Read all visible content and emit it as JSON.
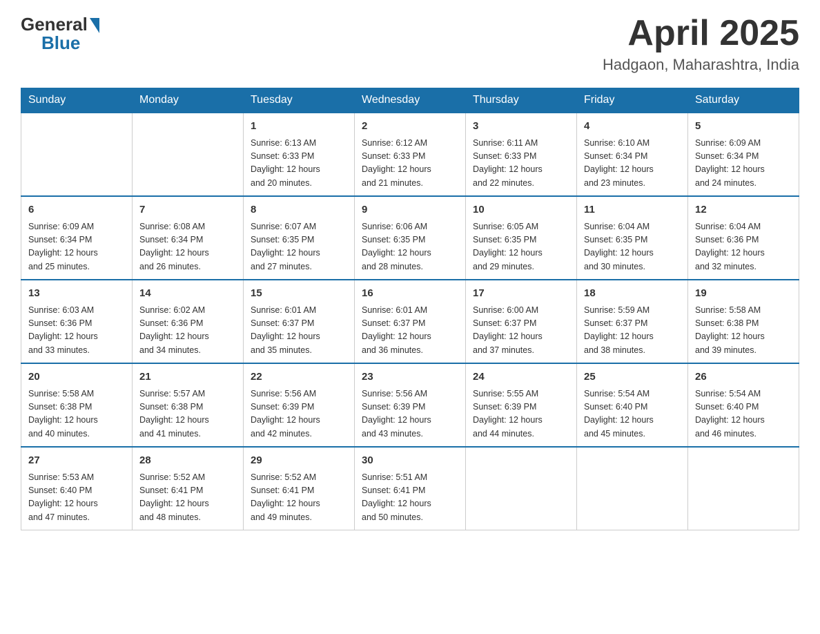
{
  "header": {
    "logo_general": "General",
    "logo_blue": "Blue",
    "month_title": "April 2025",
    "location": "Hadgaon, Maharashtra, India"
  },
  "days_of_week": [
    "Sunday",
    "Monday",
    "Tuesday",
    "Wednesday",
    "Thursday",
    "Friday",
    "Saturday"
  ],
  "weeks": [
    [
      {
        "num": "",
        "info": ""
      },
      {
        "num": "",
        "info": ""
      },
      {
        "num": "1",
        "info": "Sunrise: 6:13 AM\nSunset: 6:33 PM\nDaylight: 12 hours\nand 20 minutes."
      },
      {
        "num": "2",
        "info": "Sunrise: 6:12 AM\nSunset: 6:33 PM\nDaylight: 12 hours\nand 21 minutes."
      },
      {
        "num": "3",
        "info": "Sunrise: 6:11 AM\nSunset: 6:33 PM\nDaylight: 12 hours\nand 22 minutes."
      },
      {
        "num": "4",
        "info": "Sunrise: 6:10 AM\nSunset: 6:34 PM\nDaylight: 12 hours\nand 23 minutes."
      },
      {
        "num": "5",
        "info": "Sunrise: 6:09 AM\nSunset: 6:34 PM\nDaylight: 12 hours\nand 24 minutes."
      }
    ],
    [
      {
        "num": "6",
        "info": "Sunrise: 6:09 AM\nSunset: 6:34 PM\nDaylight: 12 hours\nand 25 minutes."
      },
      {
        "num": "7",
        "info": "Sunrise: 6:08 AM\nSunset: 6:34 PM\nDaylight: 12 hours\nand 26 minutes."
      },
      {
        "num": "8",
        "info": "Sunrise: 6:07 AM\nSunset: 6:35 PM\nDaylight: 12 hours\nand 27 minutes."
      },
      {
        "num": "9",
        "info": "Sunrise: 6:06 AM\nSunset: 6:35 PM\nDaylight: 12 hours\nand 28 minutes."
      },
      {
        "num": "10",
        "info": "Sunrise: 6:05 AM\nSunset: 6:35 PM\nDaylight: 12 hours\nand 29 minutes."
      },
      {
        "num": "11",
        "info": "Sunrise: 6:04 AM\nSunset: 6:35 PM\nDaylight: 12 hours\nand 30 minutes."
      },
      {
        "num": "12",
        "info": "Sunrise: 6:04 AM\nSunset: 6:36 PM\nDaylight: 12 hours\nand 32 minutes."
      }
    ],
    [
      {
        "num": "13",
        "info": "Sunrise: 6:03 AM\nSunset: 6:36 PM\nDaylight: 12 hours\nand 33 minutes."
      },
      {
        "num": "14",
        "info": "Sunrise: 6:02 AM\nSunset: 6:36 PM\nDaylight: 12 hours\nand 34 minutes."
      },
      {
        "num": "15",
        "info": "Sunrise: 6:01 AM\nSunset: 6:37 PM\nDaylight: 12 hours\nand 35 minutes."
      },
      {
        "num": "16",
        "info": "Sunrise: 6:01 AM\nSunset: 6:37 PM\nDaylight: 12 hours\nand 36 minutes."
      },
      {
        "num": "17",
        "info": "Sunrise: 6:00 AM\nSunset: 6:37 PM\nDaylight: 12 hours\nand 37 minutes."
      },
      {
        "num": "18",
        "info": "Sunrise: 5:59 AM\nSunset: 6:37 PM\nDaylight: 12 hours\nand 38 minutes."
      },
      {
        "num": "19",
        "info": "Sunrise: 5:58 AM\nSunset: 6:38 PM\nDaylight: 12 hours\nand 39 minutes."
      }
    ],
    [
      {
        "num": "20",
        "info": "Sunrise: 5:58 AM\nSunset: 6:38 PM\nDaylight: 12 hours\nand 40 minutes."
      },
      {
        "num": "21",
        "info": "Sunrise: 5:57 AM\nSunset: 6:38 PM\nDaylight: 12 hours\nand 41 minutes."
      },
      {
        "num": "22",
        "info": "Sunrise: 5:56 AM\nSunset: 6:39 PM\nDaylight: 12 hours\nand 42 minutes."
      },
      {
        "num": "23",
        "info": "Sunrise: 5:56 AM\nSunset: 6:39 PM\nDaylight: 12 hours\nand 43 minutes."
      },
      {
        "num": "24",
        "info": "Sunrise: 5:55 AM\nSunset: 6:39 PM\nDaylight: 12 hours\nand 44 minutes."
      },
      {
        "num": "25",
        "info": "Sunrise: 5:54 AM\nSunset: 6:40 PM\nDaylight: 12 hours\nand 45 minutes."
      },
      {
        "num": "26",
        "info": "Sunrise: 5:54 AM\nSunset: 6:40 PM\nDaylight: 12 hours\nand 46 minutes."
      }
    ],
    [
      {
        "num": "27",
        "info": "Sunrise: 5:53 AM\nSunset: 6:40 PM\nDaylight: 12 hours\nand 47 minutes."
      },
      {
        "num": "28",
        "info": "Sunrise: 5:52 AM\nSunset: 6:41 PM\nDaylight: 12 hours\nand 48 minutes."
      },
      {
        "num": "29",
        "info": "Sunrise: 5:52 AM\nSunset: 6:41 PM\nDaylight: 12 hours\nand 49 minutes."
      },
      {
        "num": "30",
        "info": "Sunrise: 5:51 AM\nSunset: 6:41 PM\nDaylight: 12 hours\nand 50 minutes."
      },
      {
        "num": "",
        "info": ""
      },
      {
        "num": "",
        "info": ""
      },
      {
        "num": "",
        "info": ""
      }
    ]
  ]
}
